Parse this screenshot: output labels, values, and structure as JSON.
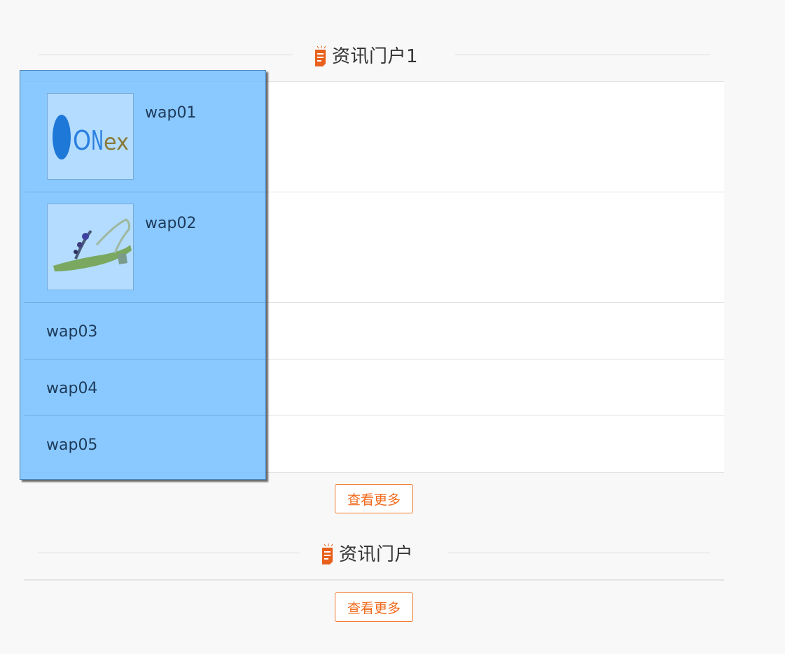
{
  "sections": [
    {
      "title": "资讯门户1",
      "more_label": "查看更多"
    },
    {
      "title": "资讯门户",
      "more_label": "查看更多"
    }
  ],
  "overlay": {
    "items": [
      {
        "label": "wap01",
        "thumb": "onex-logo-image"
      },
      {
        "label": "wap02",
        "thumb": "sandal-image"
      },
      {
        "label": "wap03"
      },
      {
        "label": "wap04"
      },
      {
        "label": "wap05"
      }
    ]
  },
  "colors": {
    "accent": "#f06a1c",
    "overlay": "#70bdff",
    "icon": "#e8601c"
  }
}
